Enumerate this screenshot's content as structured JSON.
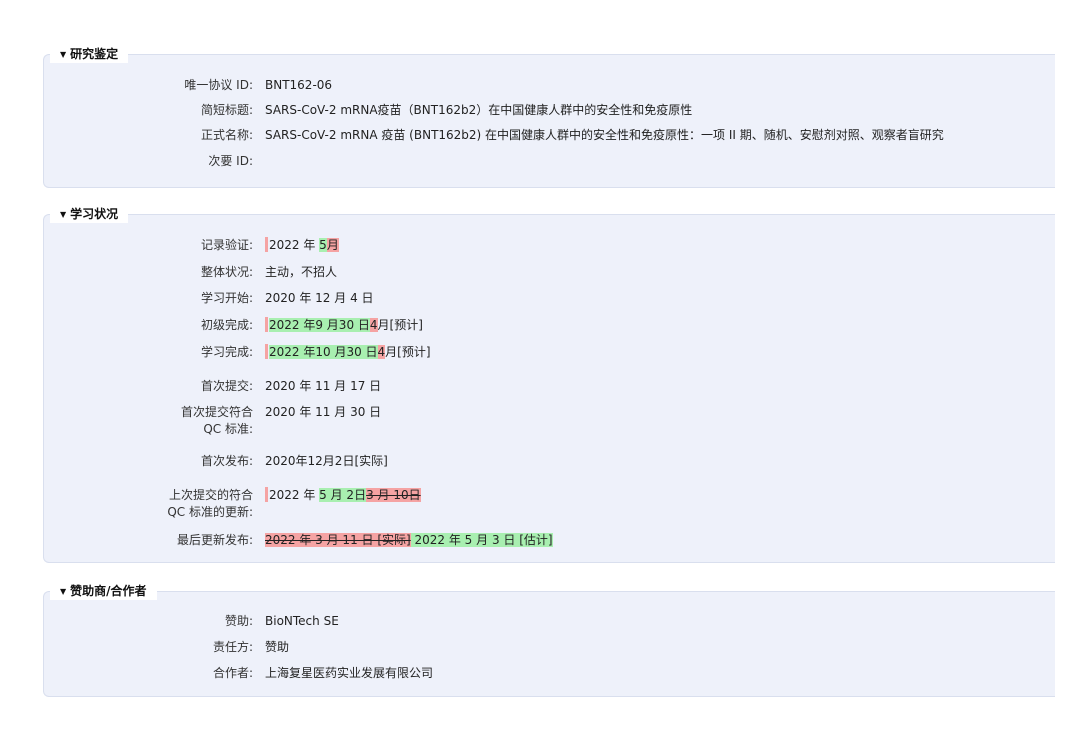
{
  "sections": {
    "identification": {
      "title": "研究鉴定",
      "unique_id_label": "唯一协议 ID:",
      "unique_id": "BNT162-06",
      "brief_title_label": "简短标题:",
      "brief_title": "SARS-CoV-2 mRNA疫苗（BNT162b2）在中国健康人群中的安全性和免疫原性",
      "official_title_label": "正式名称:",
      "official_title": "SARS-CoV-2 mRNA 疫苗 (BNT162b2) 在中国健康人群中的安全性和免疫原性：一项 II 期、随机、安慰剂对照、观察者盲研究",
      "secondary_id_label": "次要 ID:",
      "secondary_id": ""
    },
    "status": {
      "title": "学习状况",
      "record_verification_label": "记录验证:",
      "record_verification_prefix": "2022 年 ",
      "record_verification_ins": "5",
      "record_verification_del": "月",
      "overall_status_label": "整体状况:",
      "overall_status": "主动，不招人",
      "study_start_label": "学习开始:",
      "study_start": "2020 年 12 月 4 日",
      "primary_completion_label": "初级完成:",
      "primary_completion_ins": "2022 年9 月30 日",
      "primary_completion_del": "4",
      "primary_completion_suffix": "月[预计]",
      "study_completion_label": "学习完成:",
      "study_completion_ins": "2022 年10 月30 日",
      "study_completion_del": "4",
      "study_completion_suffix": "月[预计]",
      "first_submitted_label": "首次提交:",
      "first_submitted": "2020 年 11 月 17 日",
      "first_submitted_qc_label_1": "首次提交符合",
      "first_submitted_qc_label_2": "QC 标准:",
      "first_submitted_qc": "2020 年 11 月 30 日",
      "first_posted_label": "首次发布:",
      "first_posted": "2020年12月2日[实际]",
      "last_update_qc_label_1": "上次提交的符合",
      "last_update_qc_label_2": "QC 标准的更新:",
      "last_update_qc_prefix": "2022 年 ",
      "last_update_qc_ins": "5 月 2日",
      "last_update_qc_del": "3 月 10日",
      "last_update_posted_label": "最后更新发布:",
      "last_update_posted_del": "2022 年 3 月 11 日 [实际]",
      "last_update_posted_ins": " 2022 年 5 月 3 日 [估计]"
    },
    "sponsor": {
      "title": "赞助商/合作者",
      "sponsor_label": "赞助:",
      "sponsor": "BioNTech SE",
      "responsible_party_label": "责任方:",
      "responsible_party": "赞助",
      "collaborators_label": "合作者:",
      "collaborators": "上海复星医药实业发展有限公司"
    }
  },
  "colors": {
    "section_bg": "#eef1fa",
    "inserted": "#a8efb0",
    "deleted": "#f5a3a3"
  }
}
